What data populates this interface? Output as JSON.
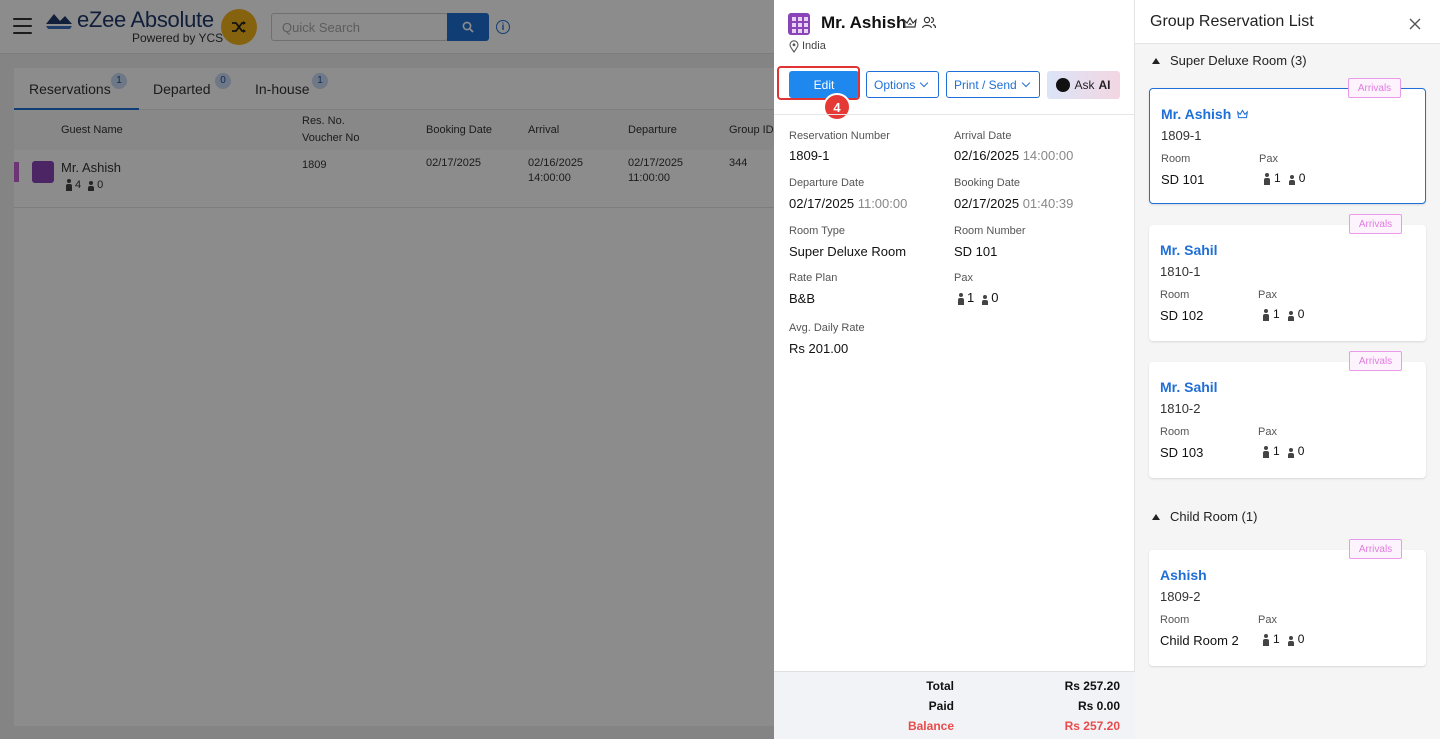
{
  "app": {
    "logo_title": "eZee Absolute",
    "logo_sub": "Powered by YCS",
    "search_placeholder": "Quick Search"
  },
  "tabs": [
    {
      "label": "Reservations",
      "count": "1"
    },
    {
      "label": "Departed",
      "count": "0"
    },
    {
      "label": "In-house",
      "count": "1"
    }
  ],
  "table": {
    "headers": {
      "guest_name": "Guest Name",
      "res_no": "Res. No.",
      "voucher_no": "Voucher No",
      "booking_date": "Booking Date",
      "arrival": "Arrival",
      "departure": "Departure",
      "group_id": "Group ID"
    },
    "rows": [
      {
        "guest_name": "Mr. Ashish",
        "adults": "4",
        "children": "0",
        "res_no": "1809",
        "booking_date": "02/17/2025",
        "arrival_date": "02/16/2025",
        "arrival_time": "14:00:00",
        "departure_date": "02/17/2025",
        "departure_time": "11:00:00",
        "group_id": "344"
      }
    ]
  },
  "detail": {
    "guest_name": "Mr. Ashish",
    "country": "India",
    "buttons": {
      "edit": "Edit",
      "options": "Options",
      "print_send": "Print / Send",
      "ask": "Ask",
      "ai": "AI"
    },
    "step_number": "4",
    "fields": {
      "reservation_number": {
        "label": "Reservation Number",
        "value": "1809-1"
      },
      "arrival_date": {
        "label": "Arrival Date",
        "value": "02/16/2025",
        "time": "14:00:00"
      },
      "departure_date": {
        "label": "Departure Date",
        "value": "02/17/2025",
        "time": "11:00:00"
      },
      "booking_date": {
        "label": "Booking Date",
        "value": "02/17/2025",
        "time": "01:40:39"
      },
      "room_type": {
        "label": "Room Type",
        "value": "Super Deluxe Room"
      },
      "room_number": {
        "label": "Room Number",
        "value": "SD 101"
      },
      "rate_plan": {
        "label": "Rate Plan",
        "value": "B&B"
      },
      "pax": {
        "label": "Pax",
        "adults": "1",
        "children": "0"
      },
      "avg_daily_rate": {
        "label": "Avg. Daily Rate",
        "value": "Rs 201.00"
      }
    },
    "totals": {
      "total_label": "Total",
      "total_value": "Rs 257.20",
      "paid_label": "Paid",
      "paid_value": "Rs 0.00",
      "balance_label": "Balance",
      "balance_value": "Rs 257.20"
    }
  },
  "group_list": {
    "title": "Group Reservation List",
    "room_label": "Room",
    "pax_label": "Pax",
    "arrivals_label": "Arrivals",
    "sections": [
      {
        "heading": "Super Deluxe Room (3)",
        "cards": [
          {
            "name": "Mr. Ashish",
            "number": "1809-1",
            "room": "SD 101",
            "adults": "1",
            "children": "0"
          },
          {
            "name": "Mr. Sahil",
            "number": "1810-1",
            "room": "SD 102",
            "adults": "1",
            "children": "0"
          },
          {
            "name": "Mr. Sahil",
            "number": "1810-2",
            "room": "SD 103",
            "adults": "1",
            "children": "0"
          }
        ]
      },
      {
        "heading": "Child Room (1)",
        "cards": [
          {
            "name": "Ashish",
            "number": "1809-2",
            "room": "Child Room 2",
            "adults": "1",
            "children": "0"
          }
        ]
      }
    ]
  },
  "colors": {
    "accent": "#1f6fd6",
    "edit_button": "#1e88ef",
    "balance_red": "#e94b4b",
    "arrivals_pink": "#e17be0",
    "step_badge": "#e53935"
  }
}
